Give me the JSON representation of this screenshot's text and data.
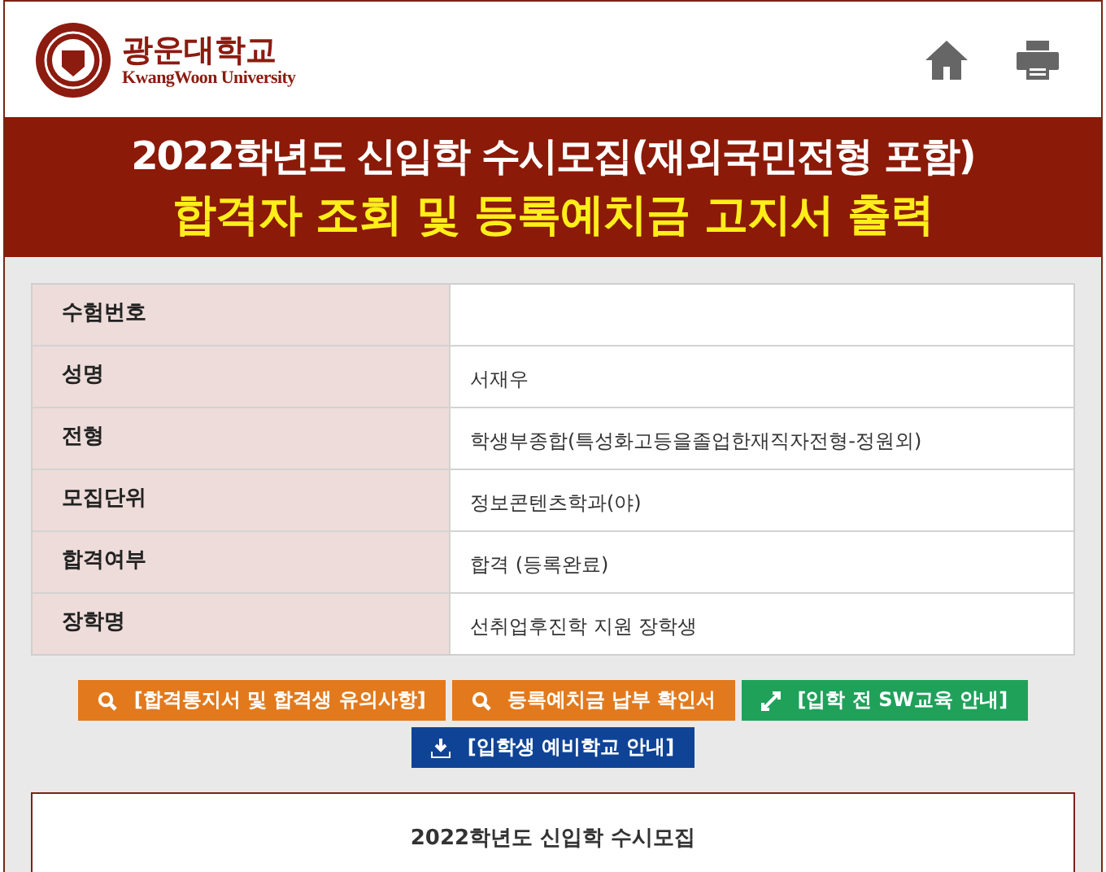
{
  "header": {
    "logo": {
      "name_ko": "광운대학교",
      "name_en": "KwangWoon University"
    },
    "icons": [
      {
        "kind": "home"
      },
      {
        "kind": "print"
      }
    ]
  },
  "banner": {
    "title": "2022학년도 신입학 수시모집(재외국민전형 포함)",
    "subtitle": "합격자 조회 및 등록예치금 고지서 출력"
  },
  "info_rows": [
    {
      "label": "수험번호"
    },
    {
      "label": "성명",
      "value": "서재우"
    },
    {
      "label": "전형",
      "value": "학생부종합(특성화고등을졸업한재직자전형-정원외)"
    },
    {
      "label": "모집단위",
      "value": "정보콘텐츠학과(야)"
    },
    {
      "label": "합격여부",
      "value": "합격 (등록완료)"
    },
    {
      "label": "장학명",
      "value": "선취업후진학 지원 장학생"
    }
  ],
  "buttons": [
    {
      "label": "[합격통지서 및 합격생 유의사항]",
      "kind": "search",
      "color": "#e27a1d"
    },
    {
      "label": "등록예치금 납부 확인서",
      "kind": "search",
      "color": "#e27a1d"
    },
    {
      "label": "[입학 전 SW교육 안내]",
      "kind": "expand",
      "color": "#1fa15a"
    },
    {
      "label": "[입학생 예비학교 안내]",
      "kind": "download",
      "color": "#0f4396"
    }
  ],
  "notice": {
    "heading": "2022학년도 신입학 수시모집"
  }
}
